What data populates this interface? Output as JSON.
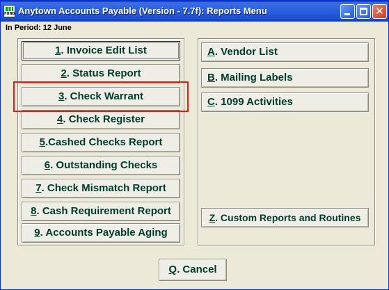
{
  "window": {
    "title": "Anytown Accounts Payable (Version - 7.7f):  Reports Menu",
    "icon_label": "FUND",
    "minimize_icon": "minimize-icon",
    "maximize_icon": "maximize-icon",
    "close_icon": "close-icon",
    "close_glyph": "✕"
  },
  "period_label": "In Period: 12 June",
  "left_menu": [
    {
      "key": "1",
      "label": ".  Invoice Edit List"
    },
    {
      "key": "2",
      "label": ". Status Report"
    },
    {
      "key": "3",
      "label": ". Check Warrant"
    },
    {
      "key": "4",
      "label": ". Check Register"
    },
    {
      "key": "5",
      "label": ".Cashed Checks Report"
    },
    {
      "key": "6",
      "label": ". Outstanding Checks"
    },
    {
      "key": "7",
      "label": ". Check Mismatch Report"
    },
    {
      "key": "8",
      "label": ". Cash Requirement Report"
    },
    {
      "key": "9",
      "label": ".  Accounts Payable Aging"
    }
  ],
  "right_menu": [
    {
      "key": "A",
      "label": ". Vendor List"
    },
    {
      "key": "B",
      "label": ". Mailing Labels"
    },
    {
      "key": "C",
      "label": ".  1099 Activities"
    },
    {
      "key": "Z",
      "label": ".  Custom Reports and Routines"
    }
  ],
  "cancel": {
    "key": "Q",
    "label": ". Cancel"
  },
  "highlight_color": "#e01b1b",
  "text_color": "#003c2c"
}
